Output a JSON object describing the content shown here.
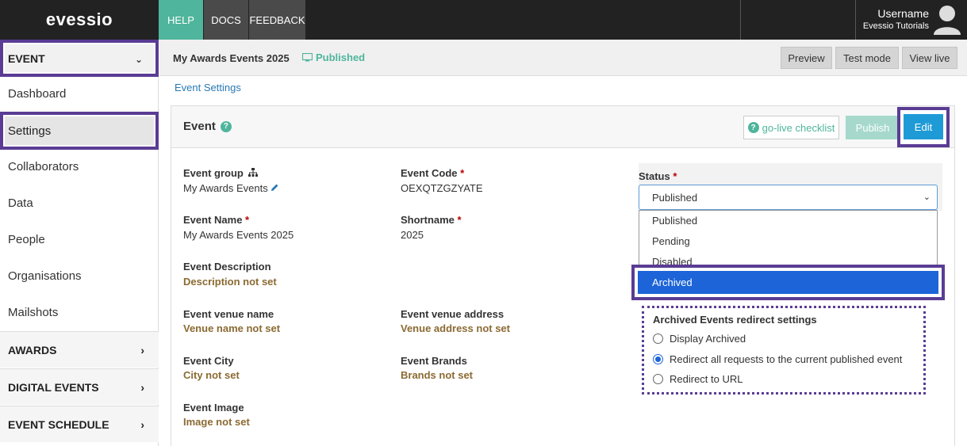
{
  "app": {
    "logo": "evessio"
  },
  "topnav": {
    "help": "HELP",
    "docs": "DOCS",
    "feedback": "FEEDBACK"
  },
  "user": {
    "name": "Username",
    "org": "Evessio Tutorials"
  },
  "sidebar": {
    "event_label": "EVENT",
    "items": [
      "Dashboard",
      "Settings",
      "Collaborators",
      "Data",
      "People",
      "Organisations",
      "Mailshots"
    ],
    "sections": [
      "AWARDS",
      "DIGITAL EVENTS",
      "EVENT SCHEDULE"
    ]
  },
  "header": {
    "event_title": "My Awards Events 2025",
    "status": "Published",
    "preview": "Preview",
    "test_mode": "Test mode",
    "view_live": "View live"
  },
  "breadcrumb": "Event Settings",
  "panel": {
    "title": "Event",
    "golive": "go-live checklist",
    "publish": "Publish",
    "edit": "Edit"
  },
  "fields": {
    "event_group_label": "Event group",
    "event_group_value": "My Awards Events",
    "event_code_label": "Event Code",
    "event_code_value": "OEXQTZGZYATE",
    "event_name_label": "Event Name",
    "event_name_value": "My Awards Events 2025",
    "shortname_label": "Shortname",
    "shortname_value": "2025",
    "description_label": "Event Description",
    "description_value": "Description not set",
    "venue_name_label": "Event venue name",
    "venue_name_value": "Venue name not set",
    "venue_address_label": "Event venue address",
    "venue_address_value": "Venue address not set",
    "city_label": "Event City",
    "city_value": "City not set",
    "brands_label": "Event Brands",
    "brands_value": "Brands not set",
    "image_label": "Event Image",
    "image_value": "Image not set",
    "required_marker": "*"
  },
  "status": {
    "label": "Status",
    "selected": "Published",
    "options": [
      "Published",
      "Pending",
      "Disabled",
      "Archived"
    ],
    "highlighted": "Archived"
  },
  "redirect": {
    "title": "Archived Events redirect settings",
    "options": [
      "Display Archived",
      "Redirect all requests to the current published event",
      "Redirect to URL"
    ],
    "selected_index": 1
  },
  "colors": {
    "accent_green": "#4fb59c",
    "edit_blue": "#1e9bd7",
    "highlight_purple": "#5a3c94",
    "dropdown_selected": "#1c64d8",
    "not_set_brown": "#8b6a32"
  }
}
